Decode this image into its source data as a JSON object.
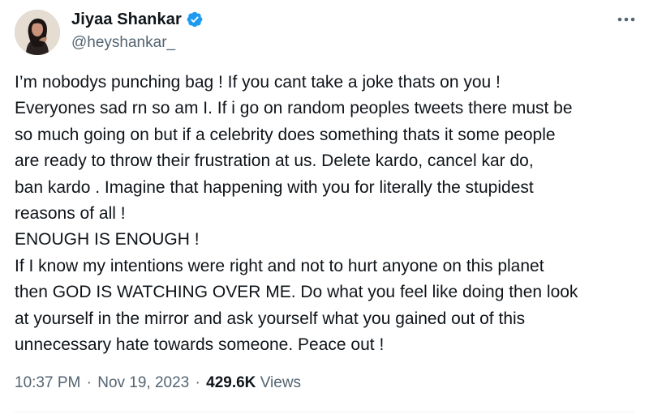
{
  "author": {
    "display_name": "Jiyaa Shankar",
    "handle": "@heyshankar_",
    "verified": true
  },
  "tweet": {
    "lines": [
      "I’m nobodys punching bag ! If you cant take a joke thats on you !",
      "Everyones sad rn so am I. If i go on random peoples tweets there must be",
      "so much going on but if a celebrity does something thats it some people",
      "are ready to throw their frustration at us. Delete kardo, cancel kar do,",
      "ban kardo . Imagine that happening with you for literally the stupidest",
      "reasons of all !",
      "ENOUGH IS ENOUGH !",
      "If I know my intentions were right and not to hurt anyone on this planet",
      "then GOD IS WATCHING OVER ME. Do what you feel like doing then look",
      "at yourself in the mirror and ask yourself what you gained out of this",
      "unnecessary hate towards someone. Peace out !"
    ]
  },
  "meta": {
    "time": "10:37 PM",
    "date": "Nov 19, 2023",
    "separator": "·",
    "views_count": "429.6K",
    "views_label": "Views"
  },
  "icons": {
    "verified": "verified-badge-icon",
    "more": "more-options-icon"
  },
  "colors": {
    "verified_blue": "#1d9bf0",
    "text_primary": "#0f1419",
    "text_secondary": "#536471"
  }
}
